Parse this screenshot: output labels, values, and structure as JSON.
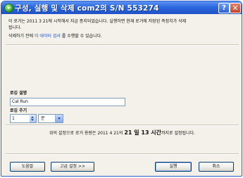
{
  "window": {
    "title": "구성, 실행 및 삭제 com2의 S/N 553274",
    "help_label": "?",
    "close_label": "✕"
  },
  "info": {
    "line1": "이 로거는 2011 3 21에 시작해서 지금 종지되었습니다. 실행하면 현재 로거에 저장된 측정치가 삭제",
    "line2": "됩니다.",
    "pre": "삭제하기 전에 ",
    "link": "이 데이터 검사",
    "post": " 를 수행할 수 있습니다."
  },
  "logging": {
    "name_label": "로깅 설명",
    "name_value": "Cal Run",
    "interval_label": "로깅 주기",
    "interval_value": "1",
    "unit_value": "분"
  },
  "summary": {
    "pre": "위의 설정으로 로거 용량은 2011 4 21의 ",
    "bold": "21 일 13 시간",
    "post": "까지로 설정됩니다."
  },
  "buttons": {
    "help": "도움말",
    "advanced": "고급 설정 >>",
    "run": "실행",
    "cancel": "취소"
  },
  "colors": {
    "titlebar": "#2d67de",
    "link": "#1a4fd6"
  }
}
